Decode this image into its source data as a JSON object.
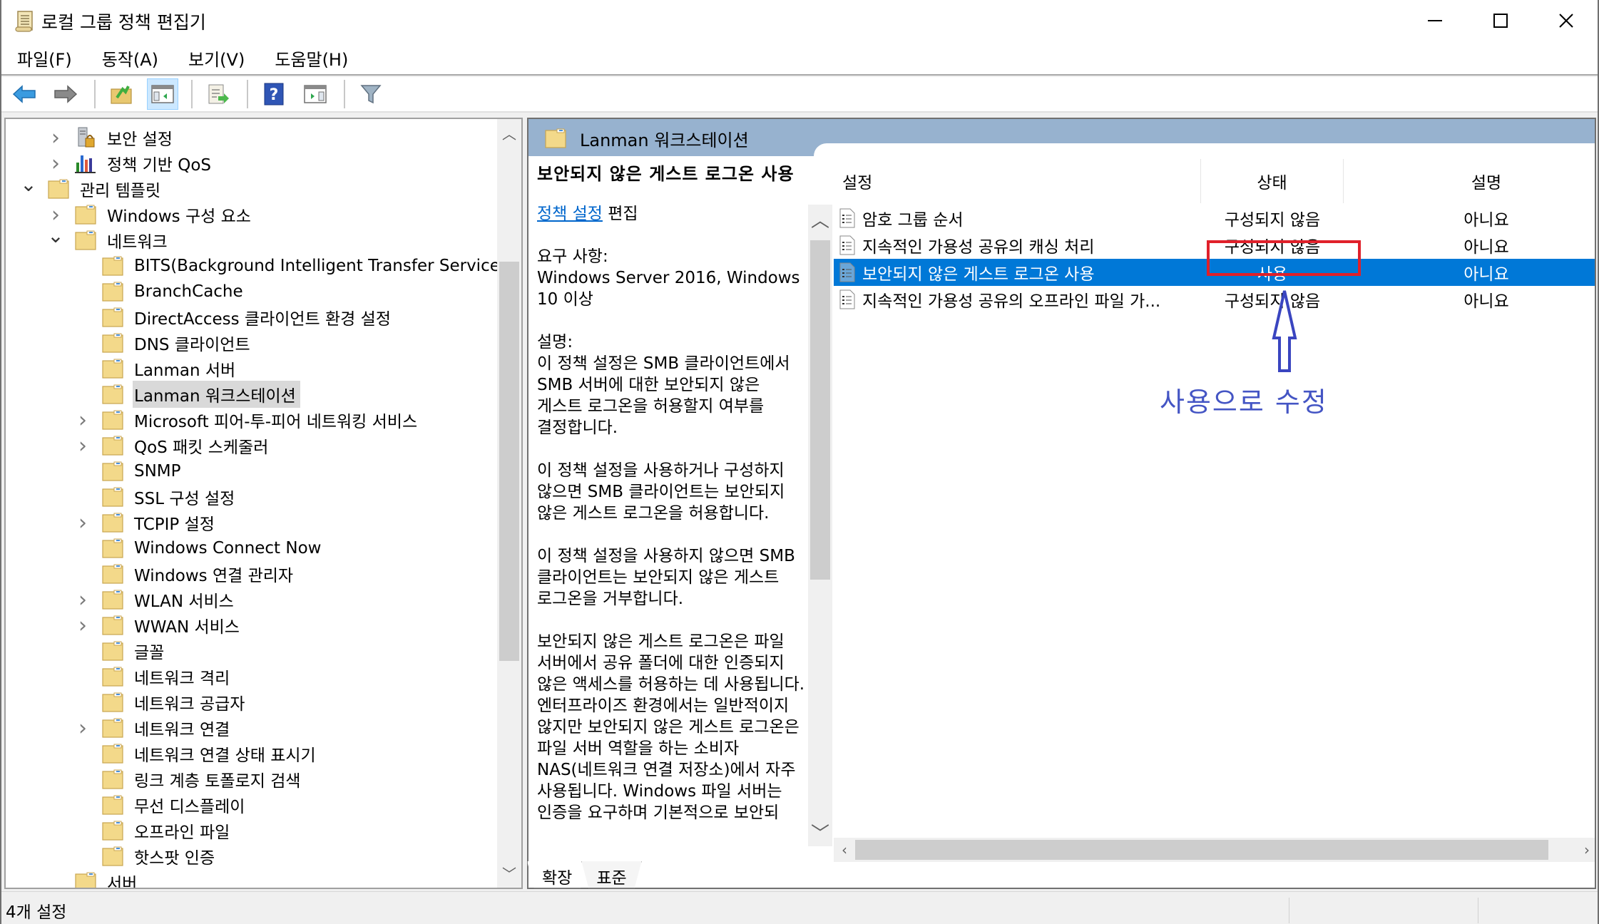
{
  "window": {
    "title": "로컬 그룹 정책 편집기",
    "controls": {
      "minimize": "minimize",
      "maximize": "maximize",
      "close": "close"
    }
  },
  "menu": [
    {
      "label": "파일(F)"
    },
    {
      "label": "동작(A)"
    },
    {
      "label": "보기(V)"
    },
    {
      "label": "도움말(H)"
    }
  ],
  "toolbar": [
    {
      "icon": "back-arrow-icon"
    },
    {
      "icon": "forward-arrow-icon"
    },
    {
      "icon": "up-folder-icon"
    },
    {
      "icon": "show-hide-console-tree-icon",
      "active": true
    },
    {
      "icon": "export-list-icon"
    },
    {
      "icon": "help-icon"
    },
    {
      "icon": "show-hide-action-pane-icon"
    },
    {
      "icon": "filter-icon"
    }
  ],
  "tree": {
    "items": [
      {
        "label": "보안 설정",
        "level": 2,
        "expander": "collapsed",
        "icon": "security-settings-icon"
      },
      {
        "label": "정책 기반 QoS",
        "level": 2,
        "expander": "collapsed",
        "icon": "qos-chart-icon"
      },
      {
        "label": "관리 템플릿",
        "level": 1,
        "expander": "expanded",
        "icon": "folder-icon"
      },
      {
        "label": "Windows 구성 요소",
        "level": 2,
        "expander": "collapsed",
        "icon": "folder-icon"
      },
      {
        "label": "네트워크",
        "level": 2,
        "expander": "expanded",
        "icon": "folder-icon"
      },
      {
        "label": "BITS(Background Intelligent Transfer Service)",
        "level": 3,
        "expander": "none",
        "icon": "folder-icon"
      },
      {
        "label": "BranchCache",
        "level": 3,
        "expander": "none",
        "icon": "folder-icon"
      },
      {
        "label": "DirectAccess 클라이언트 환경 설정",
        "level": 3,
        "expander": "none",
        "icon": "folder-icon"
      },
      {
        "label": "DNS 클라이언트",
        "level": 3,
        "expander": "none",
        "icon": "folder-icon"
      },
      {
        "label": "Lanman 서버",
        "level": 3,
        "expander": "none",
        "icon": "folder-icon"
      },
      {
        "label": "Lanman 워크스테이션",
        "level": 3,
        "expander": "none",
        "icon": "folder-icon",
        "selected": true
      },
      {
        "label": "Microsoft 피어-투-피어 네트워킹 서비스",
        "level": 3,
        "expander": "collapsed",
        "icon": "folder-icon"
      },
      {
        "label": "QoS 패킷 스케줄러",
        "level": 3,
        "expander": "collapsed",
        "icon": "folder-icon"
      },
      {
        "label": "SNMP",
        "level": 3,
        "expander": "none",
        "icon": "folder-icon"
      },
      {
        "label": "SSL 구성 설정",
        "level": 3,
        "expander": "none",
        "icon": "folder-icon"
      },
      {
        "label": "TCPIP 설정",
        "level": 3,
        "expander": "collapsed",
        "icon": "folder-icon"
      },
      {
        "label": "Windows Connect Now",
        "level": 3,
        "expander": "none",
        "icon": "folder-icon"
      },
      {
        "label": "Windows 연결 관리자",
        "level": 3,
        "expander": "none",
        "icon": "folder-icon"
      },
      {
        "label": "WLAN 서비스",
        "level": 3,
        "expander": "collapsed",
        "icon": "folder-icon"
      },
      {
        "label": "WWAN 서비스",
        "level": 3,
        "expander": "collapsed",
        "icon": "folder-icon"
      },
      {
        "label": "글꼴",
        "level": 3,
        "expander": "none",
        "icon": "folder-icon"
      },
      {
        "label": "네트워크 격리",
        "level": 3,
        "expander": "none",
        "icon": "folder-icon"
      },
      {
        "label": "네트워크 공급자",
        "level": 3,
        "expander": "none",
        "icon": "folder-icon"
      },
      {
        "label": "네트워크 연결",
        "level": 3,
        "expander": "collapsed",
        "icon": "folder-icon"
      },
      {
        "label": "네트워크 연결 상태 표시기",
        "level": 3,
        "expander": "none",
        "icon": "folder-icon"
      },
      {
        "label": "링크 계층 토폴로지 검색",
        "level": 3,
        "expander": "none",
        "icon": "folder-icon"
      },
      {
        "label": "무선 디스플레이",
        "level": 3,
        "expander": "none",
        "icon": "folder-icon"
      },
      {
        "label": "오프라인 파일",
        "level": 3,
        "expander": "none",
        "icon": "folder-icon"
      },
      {
        "label": "핫스팟 인증",
        "level": 3,
        "expander": "none",
        "icon": "folder-icon"
      },
      {
        "label": "서버",
        "level": 2,
        "expander": "none",
        "icon": "folder-icon"
      }
    ]
  },
  "content": {
    "header_title": "Lanman 워크스테이션",
    "description": {
      "title": "보안되지 않은 게스트 로그온 사용",
      "edit_link": "정책 설정",
      "edit_suffix": " 편집",
      "requirements_label": "요구 사항:",
      "requirements": "Windows Server 2016, Windows 10 이상",
      "desc_label": "설명:",
      "paragraphs": [
        "이 정책 설정은 SMB 클라이언트에서 SMB 서버에 대한 보안되지 않은 게스트 로그온을 허용할지 여부를 결정합니다.",
        "이 정책 설정을 사용하거나 구성하지 않으면 SMB 클라이언트는 보안되지 않은 게스트 로그온을 허용합니다.",
        "이 정책 설정을 사용하지 않으면 SMB 클라이언트는 보안되지 않은 게스트 로그온을 거부합니다.",
        "보안되지 않은 게스트 로그온은 파일 서버에서 공유 폴더에 대한 인증되지 않은 액세스를 허용하는 데 사용됩니다. 엔터프라이즈 환경에서는 일반적이지 않지만 보안되지 않은 게스트 로그온은 파일 서버 역할을 하는 소비자 NAS(네트워크 연결 저장소)에서 자주 사용됩니다. Windows 파일 서버는 인증을 요구하며 기본적으로 보안되"
      ]
    },
    "list": {
      "columns": [
        "설정",
        "상태",
        "설명"
      ],
      "rows": [
        {
          "name": "암호 그룹 순서",
          "state": "구성되지 않음",
          "comment": "아니요"
        },
        {
          "name": "지속적인 가용성 공유의 캐싱 처리",
          "state": "구성되지 않음",
          "comment": "아니요"
        },
        {
          "name": "보안되지 않은 게스트 로그온 사용",
          "state": "사용",
          "comment": "아니요",
          "selected": true
        },
        {
          "name": "지속적인 가용성 공유의 오프라인 파일 가...",
          "state": "구성되지 않음",
          "comment": "아니요"
        }
      ]
    },
    "tabs": [
      {
        "label": "확장",
        "active": true
      },
      {
        "label": "표준",
        "active": false
      }
    ]
  },
  "annotation": {
    "text": "사용으로 수정",
    "color": "#4455c4",
    "highlight_color": "#e0202a"
  },
  "status_bar": {
    "text": "4개 설정"
  },
  "colors": {
    "selection": "#0078d7",
    "header_band": "#97b2cf",
    "link": "#0066cc"
  }
}
